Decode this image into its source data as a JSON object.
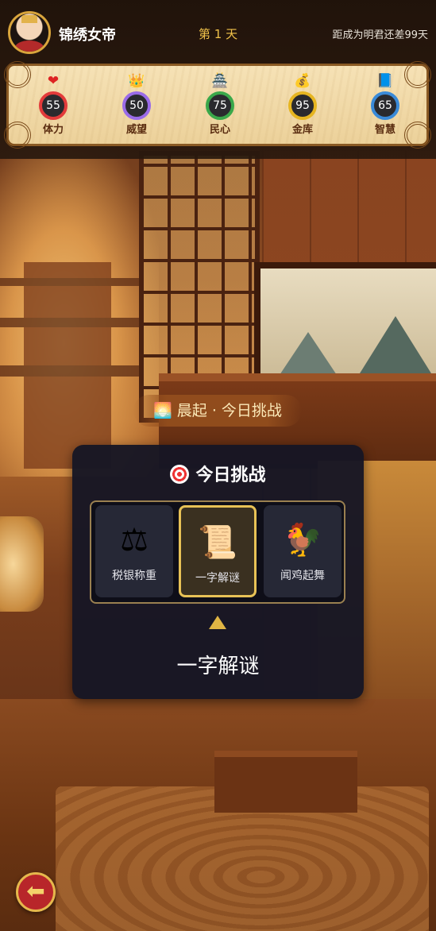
{
  "player": {
    "name": "锦绣女帝"
  },
  "header": {
    "day_label": "第 1 天",
    "goal_text": "距成为明君还差99天"
  },
  "stats": [
    {
      "icon": "heart-icon",
      "glyph": "❤",
      "value": "55",
      "label": "体力",
      "color": "#e23a3a"
    },
    {
      "icon": "crown-icon",
      "glyph": "👑",
      "value": "50",
      "label": "威望",
      "color": "#9a6be8"
    },
    {
      "icon": "palace-icon",
      "glyph": "🏯",
      "value": "75",
      "label": "民心",
      "color": "#3aa84a"
    },
    {
      "icon": "gold-ingot-icon",
      "glyph": "💰",
      "value": "95",
      "label": "金库",
      "color": "#e6b520"
    },
    {
      "icon": "scroll-icon",
      "glyph": "📘",
      "value": "65",
      "label": "智慧",
      "color": "#3a8ad8"
    }
  ],
  "banner": {
    "text": "🌅 晨起 · 今日挑战"
  },
  "challenge": {
    "title": "今日挑战",
    "options": [
      {
        "name": "税银称重",
        "icon": "scale-icon",
        "glyph": "⚖"
      },
      {
        "name": "一字解谜",
        "icon": "riddle-scroll-icon",
        "glyph": "📜"
      },
      {
        "name": "闻鸡起舞",
        "icon": "rooster-icon",
        "glyph": "🐓"
      }
    ],
    "selected_index": 1,
    "result": "一字解谜"
  },
  "nav": {
    "back_icon": "back-arrow-icon",
    "back_glyph": "⬅"
  }
}
